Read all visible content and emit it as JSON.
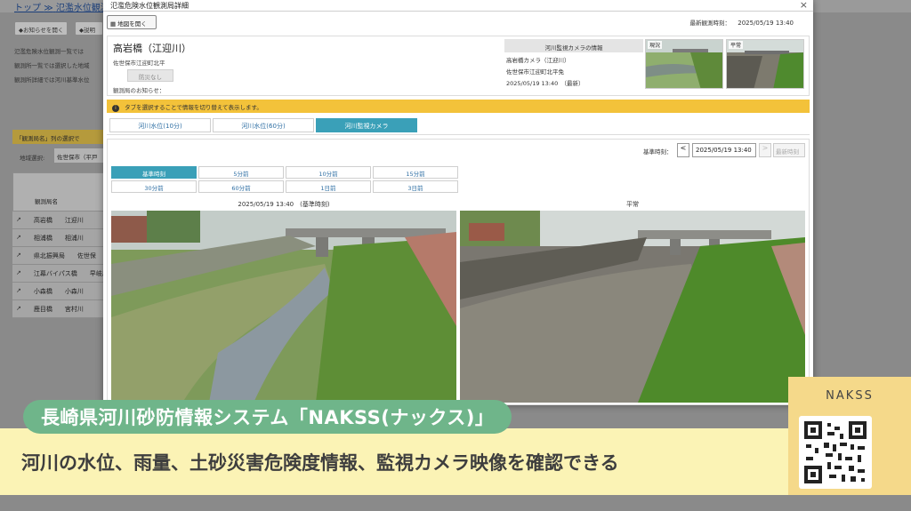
{
  "background": {
    "breadcrumb_top": "トップ",
    "breadcrumb_sep": "≫",
    "breadcrumb_page": "氾濫水位観測",
    "btn_notice_open": "◆お知らせを開く",
    "btn_help": "◆説明",
    "desc_line1": "氾濫危険水位観測一覧では",
    "desc_line2": "観測所一覧では選択した地域",
    "desc_line3": "観測所詳細では河川基準水位",
    "notice": "「観測局名」列の選択で",
    "area_label": "地域選択:",
    "area_value": "佐世保市（平戸",
    "table_header": "観測局名",
    "rows": [
      {
        "name": "高岩橋",
        "river": "江迎川"
      },
      {
        "name": "相浦橋",
        "river": "相浦川"
      },
      {
        "name": "県北振興局",
        "river": "佐世保"
      },
      {
        "name": "江幕バイパス橋",
        "river": "早岐川"
      },
      {
        "name": "小森橋",
        "river": "小森川"
      },
      {
        "name": "鹿目橋",
        "river": "宮村川"
      }
    ]
  },
  "modal": {
    "title": "氾濫危険水位観測局詳細",
    "close": "×",
    "map_button": "地図を開く",
    "latest_label": "最新観測時刻：",
    "latest_value": "2025/05/19 13:40",
    "station_name": "高岩橋（江迎川）",
    "station_address": "佐世保市江迎町北平",
    "station_button": "防災なし",
    "station_notice": "観測局のお知らせ：",
    "camera_info_title": "河川監視カメラの情報",
    "camera_name": "高岩橋カメラ（江迎川）",
    "camera_address": "佐世保市江迎町北平免",
    "camera_time": "2025/05/19 13:40　（最新）",
    "thumb_current": "現況",
    "thumb_normal": "平常",
    "info_bar": "タブを選択することで情報を切り替えて表示します。",
    "tabs": [
      "河川水位(10分)",
      "河川水位(60分)",
      "河川監視カメラ"
    ],
    "active_tab": 2,
    "ref_label": "基準時刻：",
    "ref_prev": "<",
    "ref_value": "2025/05/19 13:40",
    "ref_next": ">",
    "ref_latest": "最新時刻",
    "time_buttons": [
      "基準時刻",
      "5分前",
      "10分前",
      "15分前",
      "30分前",
      "60分前",
      "1日前",
      "3日前"
    ],
    "active_time": 0,
    "left_caption": "2025/05/19 13:40　(基準時刻)",
    "right_caption": "平常"
  },
  "overlay": {
    "title": "長崎県河川砂防情報システム「NAKSS(ナックス)」",
    "subtitle": "河川の水位、雨量、土砂災害危険度情報、監視カメラ映像を確認できる",
    "qr_label": "NAKSS"
  },
  "colors": {
    "accent_tab": "#3aa0b8",
    "info_bar": "#f3c23a",
    "caption_pill": "#6fb58a",
    "caption_band": "#fbf3b5",
    "qr_panel": "#f5d98a"
  }
}
